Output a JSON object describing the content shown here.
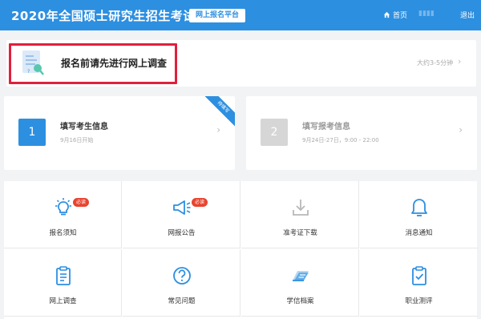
{
  "header": {
    "title": "2020年全国硕士研究生招生考试",
    "platform": "网上报名平台",
    "nav": {
      "home": "首页",
      "user": "▮▮▮▮",
      "logout": "退出"
    }
  },
  "survey": {
    "title": "报名前请先进行网上调查",
    "time_hint": "大约3-5分钟"
  },
  "steps": [
    {
      "number": "1",
      "title": "填写考生信息",
      "date": "9月16日开始",
      "ribbon": "待填写"
    },
    {
      "number": "2",
      "title": "填写报考信息",
      "date": "9月24日-27日，9:00 - 22:00"
    }
  ],
  "grid": [
    {
      "label": "报名须知",
      "icon": "bulb-icon",
      "badge": "必读"
    },
    {
      "label": "网报公告",
      "icon": "megaphone-icon",
      "badge": "必读"
    },
    {
      "label": "准考证下载",
      "icon": "download-icon"
    },
    {
      "label": "消息通知",
      "icon": "bell-icon"
    },
    {
      "label": "网上调查",
      "icon": "clipboard-icon"
    },
    {
      "label": "常见问题",
      "icon": "question-icon"
    },
    {
      "label": "学信档案",
      "icon": "archive-icon"
    },
    {
      "label": "职业测评",
      "icon": "check-clipboard-icon"
    }
  ],
  "colors": {
    "primary": "#2d8fe0",
    "highlight": "#e01f3d",
    "badge": "#e8442f",
    "disabled": "#d6d6d6"
  }
}
